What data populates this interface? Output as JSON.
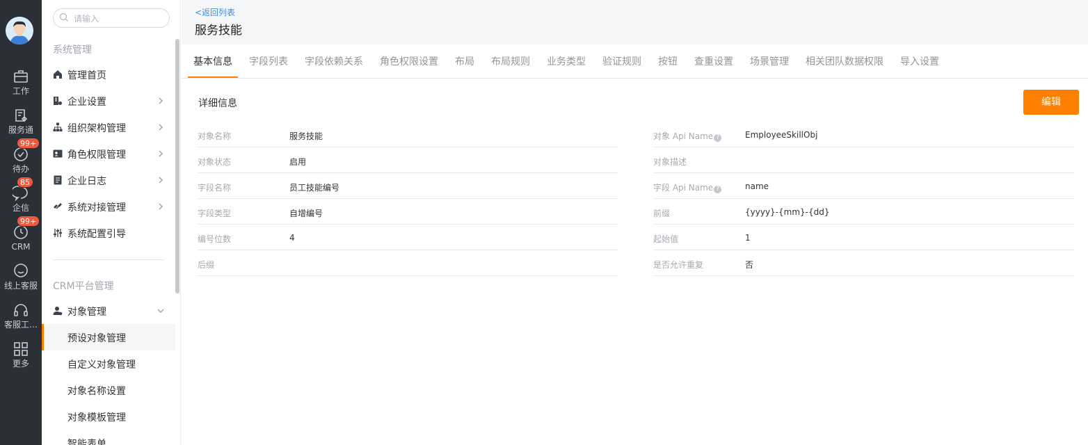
{
  "rail": {
    "items": [
      {
        "label": "工作",
        "icon": "briefcase-icon"
      },
      {
        "label": "服务通",
        "icon": "service-icon"
      },
      {
        "label": "待办",
        "icon": "check-circle-icon",
        "badge": "99+"
      },
      {
        "label": "企信",
        "icon": "chat-icon",
        "badge": "85"
      },
      {
        "label": "CRM",
        "icon": "clock-icon",
        "badge": "99+"
      },
      {
        "label": "线上客服",
        "icon": "smile-chat-icon"
      },
      {
        "label": "客服工…",
        "icon": "headset-icon"
      },
      {
        "label": "更多",
        "icon": "grid-icon"
      }
    ]
  },
  "nav": {
    "search_placeholder": "请输入",
    "section1": "系统管理",
    "items1": [
      {
        "label": "管理首页"
      },
      {
        "label": "企业设置"
      },
      {
        "label": "组织架构管理"
      },
      {
        "label": "角色权限管理"
      },
      {
        "label": "企业日志"
      },
      {
        "label": "系统对接管理"
      },
      {
        "label": "系统配置引导"
      }
    ],
    "section2": "CRM平台管理",
    "group": "对象管理",
    "sub_items": [
      {
        "label": "预设对象管理"
      },
      {
        "label": "自定义对象管理"
      },
      {
        "label": "对象名称设置"
      },
      {
        "label": "对象模板管理"
      },
      {
        "label": "智能表单"
      }
    ]
  },
  "header": {
    "back": "<返回列表",
    "title": "服务技能"
  },
  "tabs": [
    "基本信息",
    "字段列表",
    "字段依赖关系",
    "角色权限设置",
    "布局",
    "布局规则",
    "业务类型",
    "验证规则",
    "按钮",
    "查重设置",
    "场景管理",
    "相关团队数据权限",
    "导入设置"
  ],
  "detail": {
    "section_label": "详细信息",
    "edit_button": "编辑",
    "left_rows": [
      {
        "key": "对象名称",
        "value": "服务技能"
      },
      {
        "key": "对象状态",
        "value": "启用"
      },
      {
        "key": "字段名称",
        "value": "员工技能编号"
      },
      {
        "key": "字段类型",
        "value": "自增编号"
      },
      {
        "key": "编号位数",
        "value": "4"
      },
      {
        "key": "后缀",
        "value": ""
      }
    ],
    "right_rows": [
      {
        "key": "对象 Api Name",
        "value": "EmployeeSkillObj",
        "help": true
      },
      {
        "key": "对象描述",
        "value": ""
      },
      {
        "key": "字段 Api Name",
        "value": "name",
        "help": true
      },
      {
        "key": "前缀",
        "value": "{yyyy}-{mm}-{dd}"
      },
      {
        "key": "起始值",
        "value": "1"
      },
      {
        "key": "是否允许重复",
        "value": "否"
      }
    ]
  },
  "colors": {
    "accent": "#ff8000",
    "link": "#3c8ee6",
    "rail_bg": "#2b2f36",
    "badge": "#f0573d"
  }
}
